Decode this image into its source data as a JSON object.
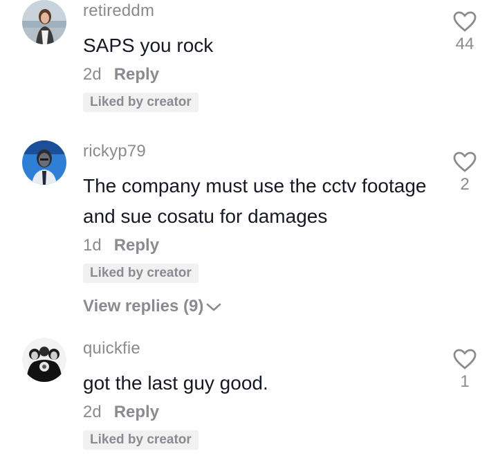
{
  "comments": [
    {
      "username": "retireddm",
      "text": "SAPS you rock",
      "time": "2d",
      "reply_label": "Reply",
      "badge": "Liked by creator",
      "likes": "44",
      "avatar_icon": "user-photo-avatar"
    },
    {
      "username": "rickyp79",
      "text": "The company must use the cctv footage and sue cosatu for damages",
      "time": "1d",
      "reply_label": "Reply",
      "badge": "Liked by creator",
      "likes": "2",
      "view_replies": "View replies (9)",
      "avatar_icon": "user-illustration-avatar"
    },
    {
      "username": "quickfie",
      "text": "got the last guy good.",
      "time": "2d",
      "reply_label": "Reply",
      "badge": "Liked by creator",
      "likes": "1",
      "avatar_icon": "user-group-photo-avatar"
    }
  ],
  "icons": {
    "like": "heart-outline-icon",
    "expand": "chevron-down-icon"
  },
  "colors": {
    "primary_text": "#161823",
    "secondary_text": "#8a8b91",
    "badge_bg": "#f1f1f2"
  }
}
